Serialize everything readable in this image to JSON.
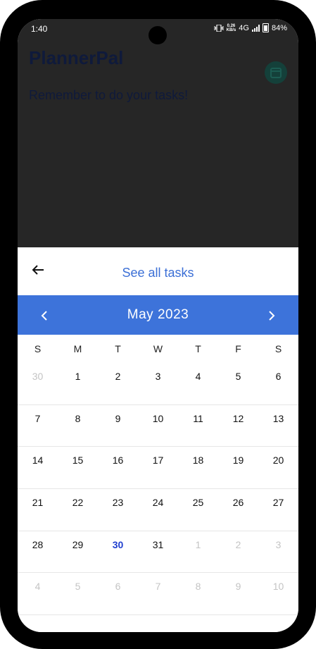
{
  "status_bar": {
    "time": "1:40",
    "speed": "0.26",
    "speed_unit": "KB/s",
    "network": "4G",
    "battery": "84%"
  },
  "app": {
    "title": "PlannerPal",
    "subtitle": "Remember to do your tasks!"
  },
  "sheet": {
    "title": "See all tasks"
  },
  "calendar": {
    "month": "May  2023",
    "weekdays": [
      "S",
      "M",
      "T",
      "W",
      "T",
      "F",
      "S"
    ],
    "weeks": [
      [
        "30",
        "1",
        "2",
        "3",
        "4",
        "5",
        "6"
      ],
      [
        "7",
        "8",
        "9",
        "10",
        "11",
        "12",
        "13"
      ],
      [
        "14",
        "15",
        "16",
        "17",
        "18",
        "19",
        "20"
      ],
      [
        "21",
        "22",
        "23",
        "24",
        "25",
        "26",
        "27"
      ],
      [
        "28",
        "29",
        "30",
        "31",
        "1",
        "2",
        "3"
      ],
      [
        "4",
        "5",
        "6",
        "7",
        "8",
        "9",
        "10"
      ]
    ],
    "colors": {
      "header_bg": "#3d73da",
      "today": "#1f3fcf",
      "out_of_month": "#c4c4c4"
    }
  },
  "icons": [
    "back-arrow-icon",
    "chevron-left-icon",
    "chevron-right-icon",
    "calendar-icon",
    "vibrate-icon",
    "signal-icon",
    "battery-icon"
  ]
}
